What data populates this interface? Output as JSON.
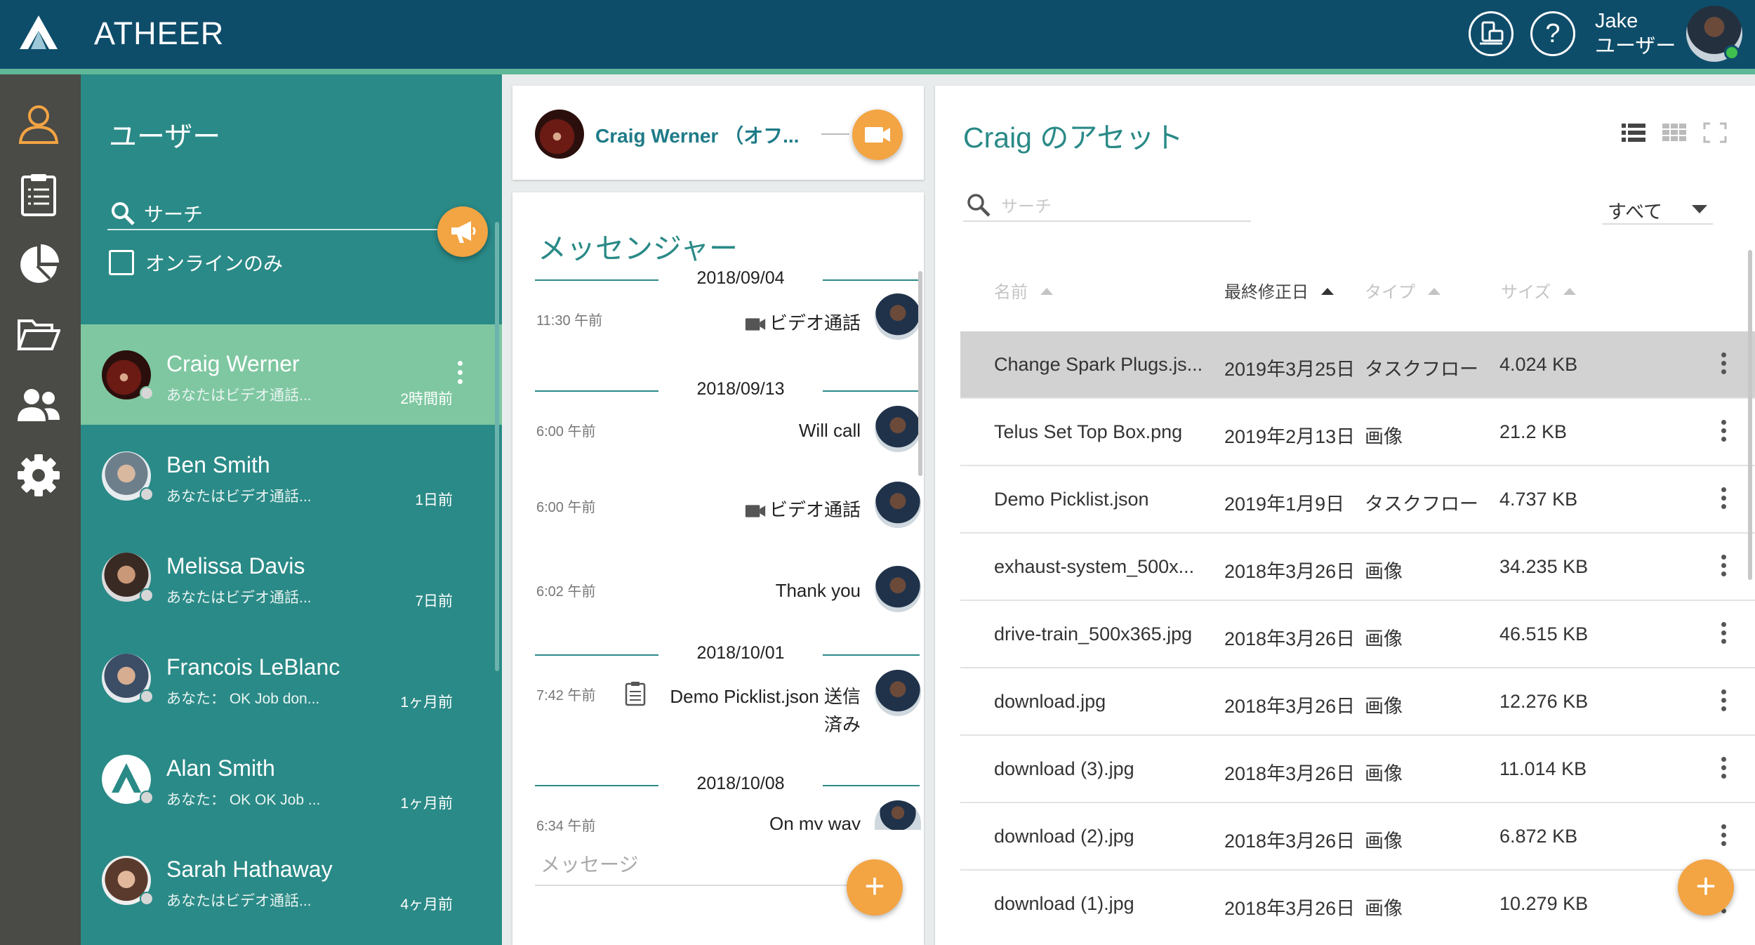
{
  "app": {
    "title": "ATHEER"
  },
  "header": {
    "user_first": "Jake",
    "user_role": "ユーザー",
    "help_label": "?"
  },
  "users_panel": {
    "title": "ユーザー",
    "search_label": "サーチ",
    "online_only_label": "オンラインのみ",
    "users": [
      {
        "name": "Craig Werner",
        "last": "あなたはビデオ通話...",
        "time": "2時間前",
        "selected": true
      },
      {
        "name": "Ben Smith",
        "last": "あなたはビデオ通話...",
        "time": "1日前"
      },
      {
        "name": "Melissa Davis",
        "last": "あなたはビデオ通話...",
        "time": "7日前"
      },
      {
        "name": "Francois LeBlanc",
        "last": "あなた：  OK Job don...",
        "time": "1ヶ月前"
      },
      {
        "name": "Alan Smith",
        "last": "あなた：  OK OK Job ...",
        "time": "1ヶ月前"
      },
      {
        "name": "Sarah Hathaway",
        "last": "あなたはビデオ通話...",
        "time": "4ヶ月前"
      }
    ]
  },
  "call": {
    "name": "Craig Werner （オフ..."
  },
  "messenger": {
    "title": "メッセンジャー",
    "input_placeholder": "メッセージ",
    "add_label": "+",
    "dates": [
      "2018/09/04",
      "2018/09/13",
      "2018/10/01",
      "2018/10/08"
    ],
    "messages": [
      {
        "time": "11:30 午前",
        "text": "ビデオ通話",
        "kind": "video"
      },
      {
        "time": "6:00 午前",
        "text": "Will call",
        "kind": "text"
      },
      {
        "time": "6:00 午前",
        "text": "ビデオ通話",
        "kind": "video"
      },
      {
        "time": "6:02 午前",
        "text": "Thank you",
        "kind": "text"
      },
      {
        "time": "7:42 午前",
        "text": "Demo Picklist.json 送信",
        "text2": "済み",
        "kind": "file"
      },
      {
        "time": "6:34 午前",
        "text": "On my way",
        "kind": "text"
      }
    ]
  },
  "assets": {
    "title": "Craig のアセット",
    "search_placeholder": "サーチ",
    "filter_value": "すべて",
    "columns": {
      "name": "名前",
      "modified": "最終修正日",
      "type": "タイプ",
      "size": "サイズ"
    },
    "add_label": "+",
    "rows": [
      {
        "name": "Change Spark Plugs.js...",
        "modified": "2019年3月25日",
        "type": "タスクフロー",
        "size": "4.024 KB",
        "selected": true
      },
      {
        "name": "Telus Set Top Box.png",
        "modified": "2019年2月13日",
        "type": "画像",
        "size": "21.2 KB"
      },
      {
        "name": "Demo Picklist.json",
        "modified": "2019年1月9日",
        "type": "タスクフロー",
        "size": "4.737 KB"
      },
      {
        "name": "exhaust-system_500x...",
        "modified": "2018年3月26日",
        "type": "画像",
        "size": "34.235 KB"
      },
      {
        "name": "drive-train_500x365.jpg",
        "modified": "2018年3月26日",
        "type": "画像",
        "size": "46.515 KB"
      },
      {
        "name": "download.jpg",
        "modified": "2018年3月26日",
        "type": "画像",
        "size": "12.276 KB"
      },
      {
        "name": "download (3).jpg",
        "modified": "2018年3月26日",
        "type": "画像",
        "size": "11.014 KB"
      },
      {
        "name": "download (2).jpg",
        "modified": "2018年3月26日",
        "type": "画像",
        "size": "6.872 KB"
      },
      {
        "name": "download (1).jpg",
        "modified": "2018年3月26日",
        "type": "画像",
        "size": "10.279 KB"
      }
    ]
  },
  "colors": {
    "topbar": "#0e4d6a",
    "accent": "#5fb897",
    "panel": "#2a8a87",
    "selected_row": "#7ec7a1",
    "orange": "#f3a443",
    "rail": "#4a4a46"
  }
}
